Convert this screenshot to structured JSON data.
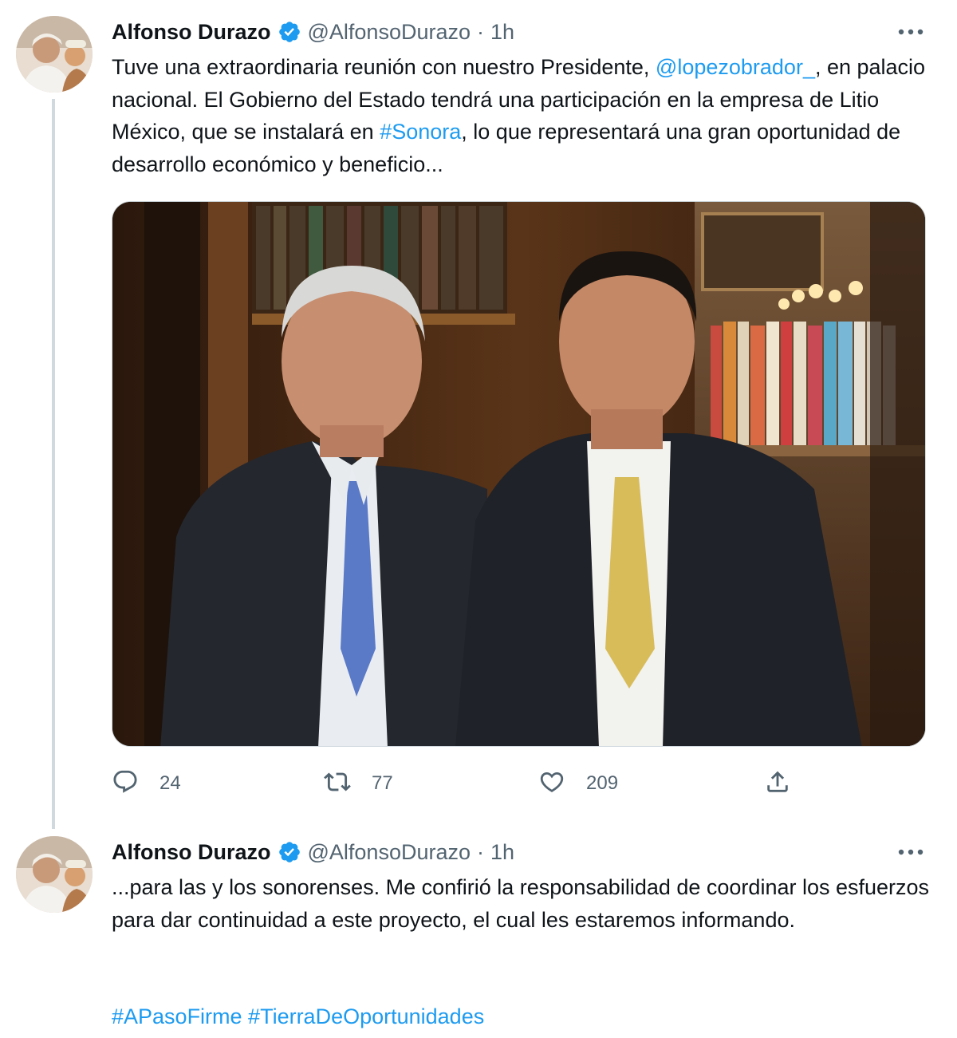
{
  "tweets": [
    {
      "author_name": "Alfonso Durazo",
      "handle": "@AlfonsoDurazo",
      "separator": "·",
      "time": "1h",
      "text_parts": {
        "p1": "Tuve una extraordinaria reunión con nuestro Presidente, ",
        "mention": "@lopezobrador_",
        "p2": ", en palacio nacional. El Gobierno del Estado tendrá una participación en la empresa de Litio México, que se instalará en ",
        "hashtag": "#Sonora",
        "p3": ", lo que representará una gran oportunidad de desarrollo económico y beneficio..."
      },
      "actions": {
        "replies": "24",
        "retweets": "77",
        "likes": "209"
      }
    },
    {
      "author_name": "Alfonso Durazo",
      "handle": "@AlfonsoDurazo",
      "separator": "·",
      "time": "1h",
      "text": "...para las y los sonorenses. Me confirió la responsabilidad de coordinar los esfuerzos para dar continuidad a este proyecto, el cual les estaremos informando.",
      "hashtags": "#APasoFirme #TierraDeOportunidades"
    }
  ],
  "icons": {
    "verified": "verified-badge-icon",
    "more": "more-dots-icon",
    "reply": "reply-icon",
    "retweet": "retweet-icon",
    "like": "heart-icon",
    "share": "share-icon"
  },
  "colors": {
    "accent": "#1d9bf0",
    "text": "#0f1419",
    "secondary": "#536471",
    "border": "#cfd9de"
  }
}
